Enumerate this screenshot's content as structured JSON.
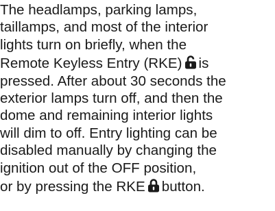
{
  "document": {
    "lines": [
      "The headlamps, parking lamps,",
      "taillamps, and most of the interior",
      "lights turn on briefly, when the",
      "Remote Keyless Entry (RKE)",
      "is",
      "pressed. After about 30 seconds the",
      "exterior lamps turn off, and then the",
      "dome and remaining interior lights",
      "will dim to off. Entry lighting can be",
      "disabled manually by changing the",
      "ignition out of the OFF position,",
      "or by pressing the RKE",
      "button."
    ],
    "icons": {
      "unlock": "unlock-padlock-icon",
      "lock": "lock-padlock-icon"
    }
  }
}
